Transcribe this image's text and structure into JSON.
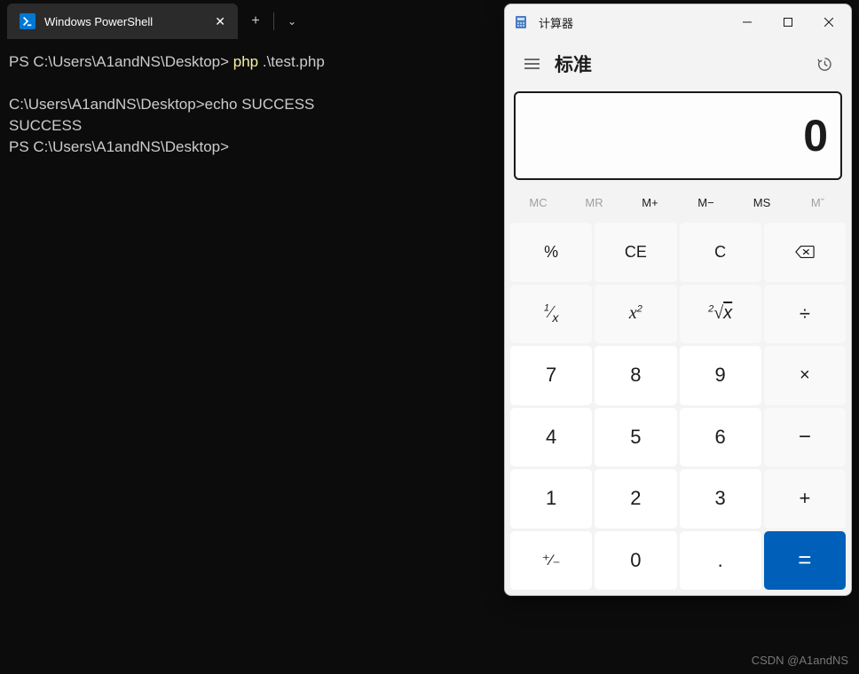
{
  "terminal": {
    "tab_title": "Windows PowerShell",
    "lines": {
      "p1_prefix": "PS C:\\Users\\A1andNS\\Desktop> ",
      "p1_cmd_a": "php ",
      "p1_cmd_b": ".\\test.php",
      "blank": "",
      "l2": "C:\\Users\\A1andNS\\Desktop>echo SUCCESS",
      "l3": "SUCCESS",
      "l4": "PS C:\\Users\\A1andNS\\Desktop> "
    }
  },
  "calc": {
    "title": "计算器",
    "mode": "标准",
    "display": "0",
    "mem": {
      "mc": "MC",
      "mr": "MR",
      "mplus": "M+",
      "mminus": "M−",
      "ms": "MS",
      "mv": "Mˇ"
    },
    "keys": {
      "percent": "%",
      "ce": "CE",
      "c": "C",
      "recip": "¹⁄ₓ",
      "sq": "x²",
      "sqrt": "²√x",
      "div": "÷",
      "k7": "7",
      "k8": "8",
      "k9": "9",
      "mul": "×",
      "k4": "4",
      "k5": "5",
      "k6": "6",
      "sub": "−",
      "k1": "1",
      "k2": "2",
      "k3": "3",
      "add": "+",
      "pm": "⁺⁄₋",
      "k0": "0",
      "dot": ".",
      "eq": "="
    }
  },
  "watermark": "CSDN @A1andNS"
}
